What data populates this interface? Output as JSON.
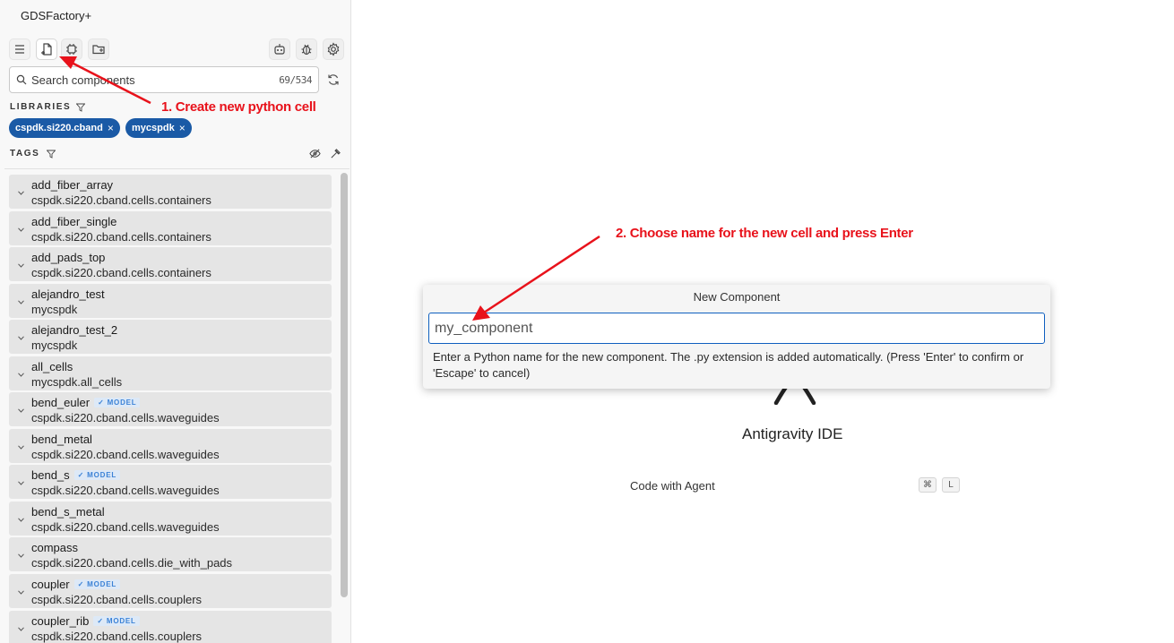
{
  "app": {
    "title": "GDSFactory+"
  },
  "toolbar": {
    "icons": [
      "menu-icon",
      "new-python-cell-icon",
      "chip-icon",
      "add-folder-icon",
      "robot-icon",
      "bug-icon",
      "gear-icon"
    ]
  },
  "search": {
    "placeholder": "Search components",
    "count": "69/534"
  },
  "libraries": {
    "label": "LIBRARIES",
    "chips": [
      {
        "label": "cspdk.si220.cband",
        "remove": "×"
      },
      {
        "label": "mycspdk",
        "remove": "×"
      }
    ],
    "chip_color": "#1a5aa6"
  },
  "tags": {
    "label": "TAGS"
  },
  "components": [
    {
      "name": "add_fiber_array",
      "module": "cspdk.si220.cband.cells.containers",
      "badge": ""
    },
    {
      "name": "add_fiber_single",
      "module": "cspdk.si220.cband.cells.containers",
      "badge": ""
    },
    {
      "name": "add_pads_top",
      "module": "cspdk.si220.cband.cells.containers",
      "badge": ""
    },
    {
      "name": "alejandro_test",
      "module": "mycspdk",
      "badge": ""
    },
    {
      "name": "alejandro_test_2",
      "module": "mycspdk",
      "badge": ""
    },
    {
      "name": "all_cells",
      "module": "mycspdk.all_cells",
      "badge": ""
    },
    {
      "name": "bend_euler",
      "module": "cspdk.si220.cband.cells.waveguides",
      "badge": "✓ MODEL"
    },
    {
      "name": "bend_metal",
      "module": "cspdk.si220.cband.cells.waveguides",
      "badge": ""
    },
    {
      "name": "bend_s",
      "module": "cspdk.si220.cband.cells.waveguides",
      "badge": "✓ MODEL"
    },
    {
      "name": "bend_s_metal",
      "module": "cspdk.si220.cband.cells.waveguides",
      "badge": ""
    },
    {
      "name": "compass",
      "module": "cspdk.si220.cband.cells.die_with_pads",
      "badge": ""
    },
    {
      "name": "coupler",
      "module": "cspdk.si220.cband.cells.couplers",
      "badge": "✓ MODEL"
    },
    {
      "name": "coupler_rib",
      "module": "cspdk.si220.cband.cells.couplers",
      "badge": "✓ MODEL"
    }
  ],
  "main": {
    "ide_title": "Antigravity IDE",
    "code_with_agent": "Code with Agent",
    "shortcut_keys": [
      "⌘",
      "L"
    ]
  },
  "dialog": {
    "title": "New Component",
    "value": "my_component",
    "help": "Enter a Python name for the new component. The .py extension is added automatically. (Press 'Enter' to confirm or 'Escape' to cancel)"
  },
  "annotations": {
    "step1": "1. Create new python cell",
    "step2": "2. Choose name for the new cell and press Enter",
    "color": "#e8121b"
  }
}
